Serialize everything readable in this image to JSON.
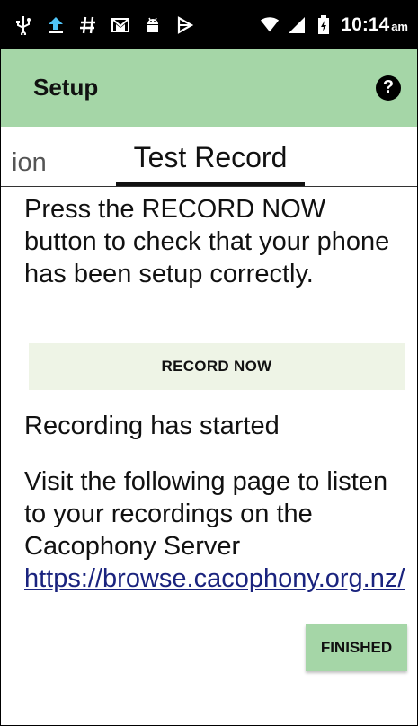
{
  "status_bar": {
    "time": "10:14",
    "ampm": "am",
    "left_icons": [
      "usb-icon",
      "upload-icon",
      "hash-icon",
      "gmail-icon",
      "android-debug-icon",
      "play-icon"
    ],
    "right_icons": [
      "wifi-icon",
      "signal-icon",
      "battery-icon"
    ]
  },
  "toolbar": {
    "title": "Setup",
    "help_label": "?",
    "color": "#a5d6a7"
  },
  "tabs": {
    "previous_partial": "ion",
    "active": "Test Record"
  },
  "content": {
    "instructions": "Press the RECORD NOW button to check that your phone has been setup correctly.",
    "record_button": "RECORD NOW",
    "status_message": "Recording has started",
    "visit_text": "Visit the following page to listen to your recordings on the Cacophony Server ",
    "link_text": "https://browse.cacophony.org.nz/",
    "finished_button": "FINISHED"
  }
}
